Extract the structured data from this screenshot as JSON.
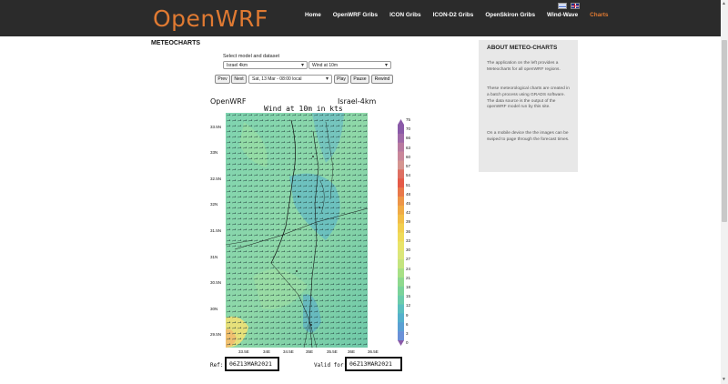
{
  "header": {
    "logo": "OpenWRF",
    "nav": [
      {
        "label": "Home",
        "active": false
      },
      {
        "label": "OpenWRF Gribs",
        "active": false
      },
      {
        "label": "ICON Gribs",
        "active": false
      },
      {
        "label": "ICON-D2 Gribs",
        "active": false
      },
      {
        "label": "OpenSkiron Gribs",
        "active": false
      },
      {
        "label": "Wind-Wave",
        "active": false
      },
      {
        "label": "Charts",
        "active": true
      }
    ]
  },
  "main": {
    "page_title": "METEOCHARTS",
    "select_label": "Select model and dataset",
    "model_select": "Israel 4km",
    "dataset_select": "Wind at 10m",
    "datetime_select": "Sat, 13 Mar - 08:00 local",
    "buttons": {
      "prev": "Prev",
      "next": "Next",
      "play": "Play",
      "pause": "Pause",
      "rewind": "Rewind"
    }
  },
  "chart": {
    "source": "OpenWRF",
    "title": "Wind at 10m in kts",
    "region": "Israel-4km",
    "lat_labels": [
      "33.5N",
      "33N",
      "32.5N",
      "32N",
      "31.5N",
      "31N",
      "30.5N",
      "30N",
      "29.5N"
    ],
    "lon_labels": [
      "33.5E",
      "34E",
      "34.5E",
      "35E",
      "35.5E",
      "36E",
      "36.5E"
    ],
    "colorbar_values": [
      75,
      70,
      66,
      63,
      60,
      57,
      54,
      51,
      48,
      45,
      42,
      39,
      36,
      33,
      30,
      27,
      24,
      21,
      18,
      15,
      12,
      9,
      6,
      3,
      0
    ],
    "ref_label": "Ref:",
    "ref_time": "06Z13MAR2021",
    "valid_label": "Valid for:",
    "valid_time": "06Z13MAR2021"
  },
  "sidebar": {
    "title": "ABOUT METEO-CHARTS",
    "paragraphs": [
      "The application on the left provides a Meteocharts for all openWRF regions.",
      "These meteorological charts are created in a batch process using GRADS software. The data source is the output of the openWRF model run by this site.",
      "On a mobile device the the images can be swiped to page through the forecast times."
    ]
  }
}
